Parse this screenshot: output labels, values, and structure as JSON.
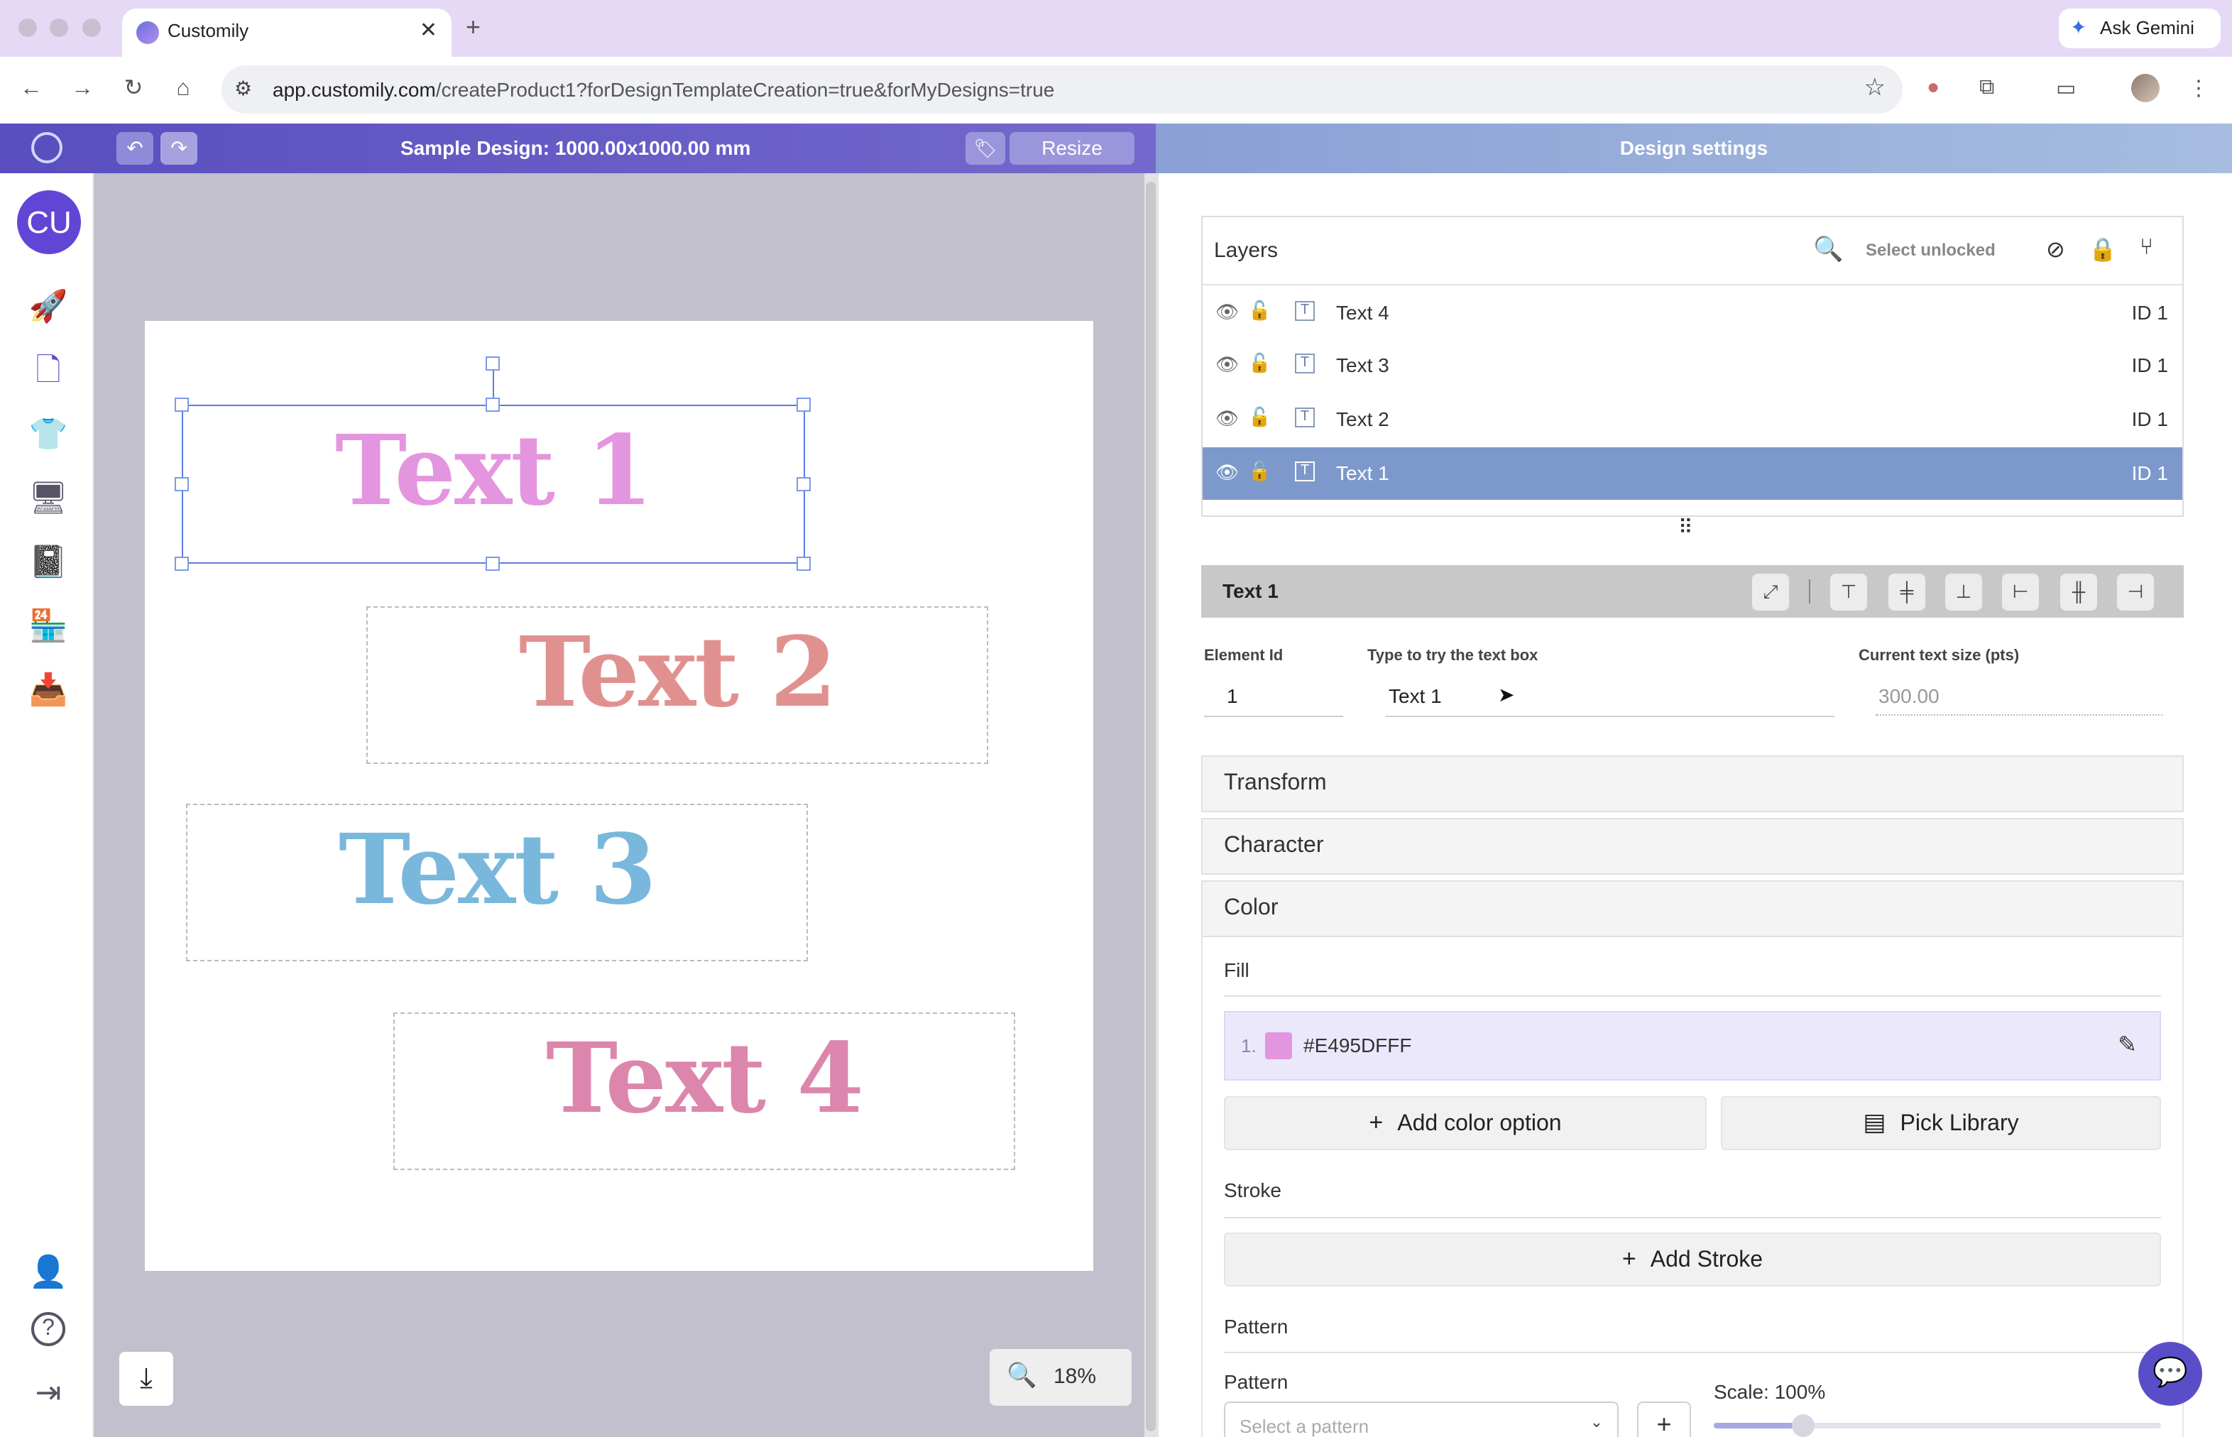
{
  "browser": {
    "tab_title": "Customily",
    "new_tab": "+",
    "close_tab": "✕",
    "gemini_label": "Ask Gemini",
    "url_host": "app.customily.com",
    "url_path": "/createProduct1?forDesignTemplateCreation=true&forMyDesigns=true"
  },
  "header": {
    "design_title": "Sample Design: 1000.00x1000.00 mm",
    "resize_label": "Resize",
    "settings_title": "Design settings",
    "undo_glyph": "↶",
    "redo_glyph": "↷"
  },
  "sidebar": {
    "avatar": "CU",
    "items": [
      {
        "icon": "rocket-icon",
        "glyph": "🚀"
      },
      {
        "icon": "document-icon",
        "glyph": "🗋"
      },
      {
        "icon": "tshirt-icon",
        "glyph": "👕"
      },
      {
        "icon": "monitor-icon",
        "glyph": "🖥"
      },
      {
        "icon": "book-icon",
        "glyph": "📓"
      },
      {
        "icon": "store-icon",
        "glyph": "🏪"
      },
      {
        "icon": "inbox-icon",
        "glyph": "📥"
      }
    ],
    "bottom": [
      {
        "icon": "user-settings-icon",
        "glyph": "👤"
      },
      {
        "icon": "help-icon",
        "glyph": "?"
      },
      {
        "icon": "logout-icon",
        "glyph": "⇥"
      }
    ]
  },
  "canvas": {
    "texts": [
      {
        "label": "Text 1",
        "color": "#E495DF"
      },
      {
        "label": "Text 2",
        "color": "#E0918F"
      },
      {
        "label": "Text 3",
        "color": "#79B8DC"
      },
      {
        "label": "Text 4",
        "color": "#DC86AD"
      }
    ],
    "zoom": "18%"
  },
  "layers": {
    "title": "Layers",
    "select_unlocked": "Select unlocked",
    "rows": [
      {
        "name": "Text 4",
        "id": "ID 1",
        "selected": false
      },
      {
        "name": "Text 3",
        "id": "ID 1",
        "selected": false
      },
      {
        "name": "Text 2",
        "id": "ID 1",
        "selected": false
      },
      {
        "name": "Text 1",
        "id": "ID 1",
        "selected": true
      }
    ]
  },
  "element": {
    "title": "Text 1",
    "element_id_label": "Element Id",
    "element_id_value": "1",
    "text_label": "Type to try the text box",
    "text_value": "Text 1",
    "size_label": "Current text size (pts)",
    "size_value": "300.00"
  },
  "sections": {
    "transform": "Transform",
    "character": "Character",
    "color": "Color"
  },
  "color": {
    "fill_label": "Fill",
    "fill_index": "1.",
    "fill_hex": "#E495DFFF",
    "fill_swatch": "#E495DF",
    "add_color_option": "Add color option",
    "pick_library": "Pick Library",
    "stroke_label": "Stroke",
    "add_stroke": "Add Stroke",
    "pattern_section": "Pattern",
    "pattern_label": "Pattern",
    "pattern_placeholder": "Select a pattern",
    "scale_label": "Scale: 100%",
    "scale_value": 0.2
  },
  "colors": {
    "accent": "#5B4FD0",
    "layer_selected": "#7D99CB",
    "fill_row_bg": "#ECE8FB"
  }
}
